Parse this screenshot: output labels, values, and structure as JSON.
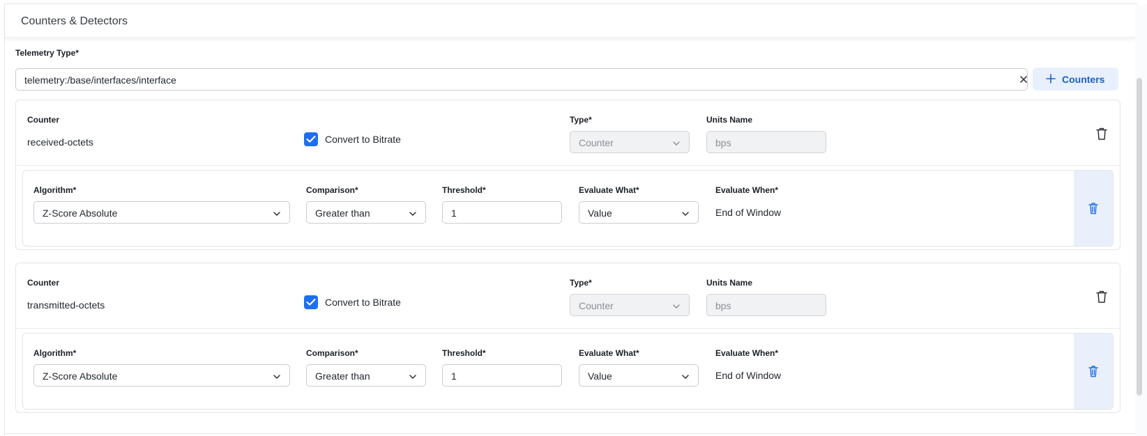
{
  "section": {
    "title": "Counters & Detectors"
  },
  "telemetry": {
    "label": "Telemetry Type*",
    "value": "telemetry:/base/interfaces/interface",
    "clear_icon": "close-icon",
    "add_button_label": "Counters",
    "add_icon": "plus-icon"
  },
  "counters": [
    {
      "counter_label": "Counter",
      "counter_name": "received-octets",
      "convert_label": "Convert to Bitrate",
      "convert_checked": true,
      "type_label": "Type*",
      "type_value": "Counter",
      "units_label": "Units Name",
      "units_value": "bps",
      "detector": {
        "algorithm_label": "Algorithm*",
        "algorithm_value": "Z-Score Absolute",
        "comparison_label": "Comparison*",
        "comparison_value": "Greater than",
        "threshold_label": "Threshold*",
        "threshold_value": "1",
        "evaluate_what_label": "Evaluate What*",
        "evaluate_what_value": "Value",
        "evaluate_when_label": "Evaluate When*",
        "evaluate_when_value": "End of Window"
      }
    },
    {
      "counter_label": "Counter",
      "counter_name": "transmitted-octets",
      "convert_label": "Convert to Bitrate",
      "convert_checked": true,
      "type_label": "Type*",
      "type_value": "Counter",
      "units_label": "Units Name",
      "units_value": "bps",
      "detector": {
        "algorithm_label": "Algorithm*",
        "algorithm_value": "Z-Score Absolute",
        "comparison_label": "Comparison*",
        "comparison_value": "Greater than",
        "threshold_label": "Threshold*",
        "threshold_value": "1",
        "evaluate_what_label": "Evaluate What*",
        "evaluate_what_value": "Value",
        "evaluate_when_label": "Evaluate When*",
        "evaluate_when_value": "End of Window"
      }
    }
  ],
  "colors": {
    "accent": "#1d6ef2",
    "button_bg": "#e8f0fd",
    "delete_zone_bg": "#e9f0fb"
  }
}
